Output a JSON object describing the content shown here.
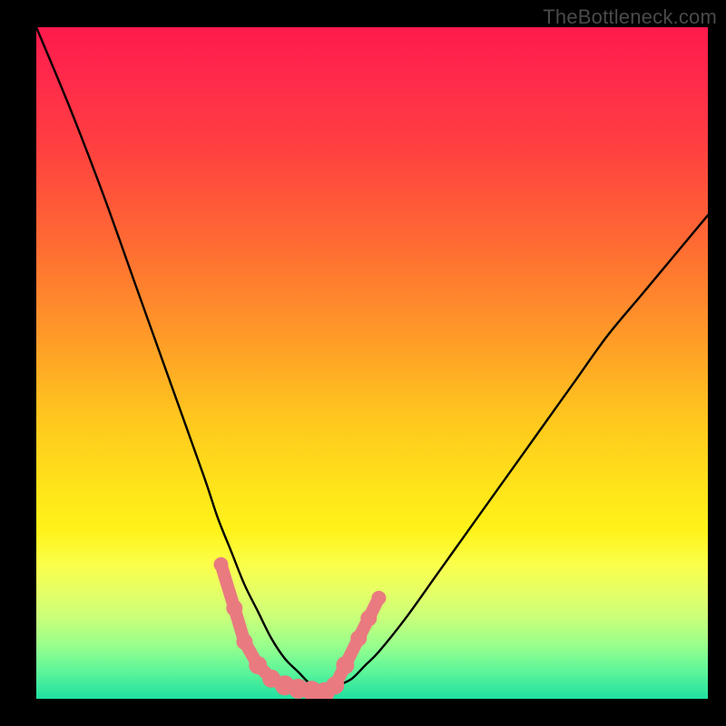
{
  "watermark": "TheBottleneck.com",
  "chart_data": {
    "type": "line",
    "title": "",
    "xlabel": "",
    "ylabel": "",
    "xlim": [
      0,
      100
    ],
    "ylim": [
      0,
      100
    ],
    "grid": false,
    "legend": false,
    "series": [
      {
        "name": "left-curve",
        "x": [
          0,
          5,
          10,
          15,
          20,
          25,
          27,
          29,
          31,
          33,
          35,
          37,
          39,
          41,
          43
        ],
        "values": [
          100,
          88,
          75,
          61,
          47,
          33,
          27,
          22,
          17,
          13,
          9,
          6,
          4,
          2,
          1
        ]
      },
      {
        "name": "right-curve",
        "x": [
          43,
          45,
          47,
          49,
          51,
          55,
          60,
          65,
          70,
          75,
          80,
          85,
          90,
          95,
          100
        ],
        "values": [
          1,
          2,
          3,
          5,
          7,
          12,
          19,
          26,
          33,
          40,
          47,
          54,
          60,
          66,
          72
        ]
      },
      {
        "name": "left-dots",
        "x": [
          27.5,
          29.5,
          31.0,
          33.0,
          35.0,
          37.0,
          39.0,
          41.0,
          43.0
        ],
        "values": [
          20.0,
          13.5,
          8.5,
          5.0,
          3.0,
          2.0,
          1.5,
          1.2,
          1.0
        ]
      },
      {
        "name": "right-dots",
        "x": [
          44.5,
          46.0,
          48.0,
          49.5,
          51.0
        ],
        "values": [
          2.0,
          5.0,
          9.0,
          12.0,
          15.0
        ]
      }
    ],
    "colors": {
      "curve": "#000000",
      "dots": "#e97a80"
    }
  }
}
